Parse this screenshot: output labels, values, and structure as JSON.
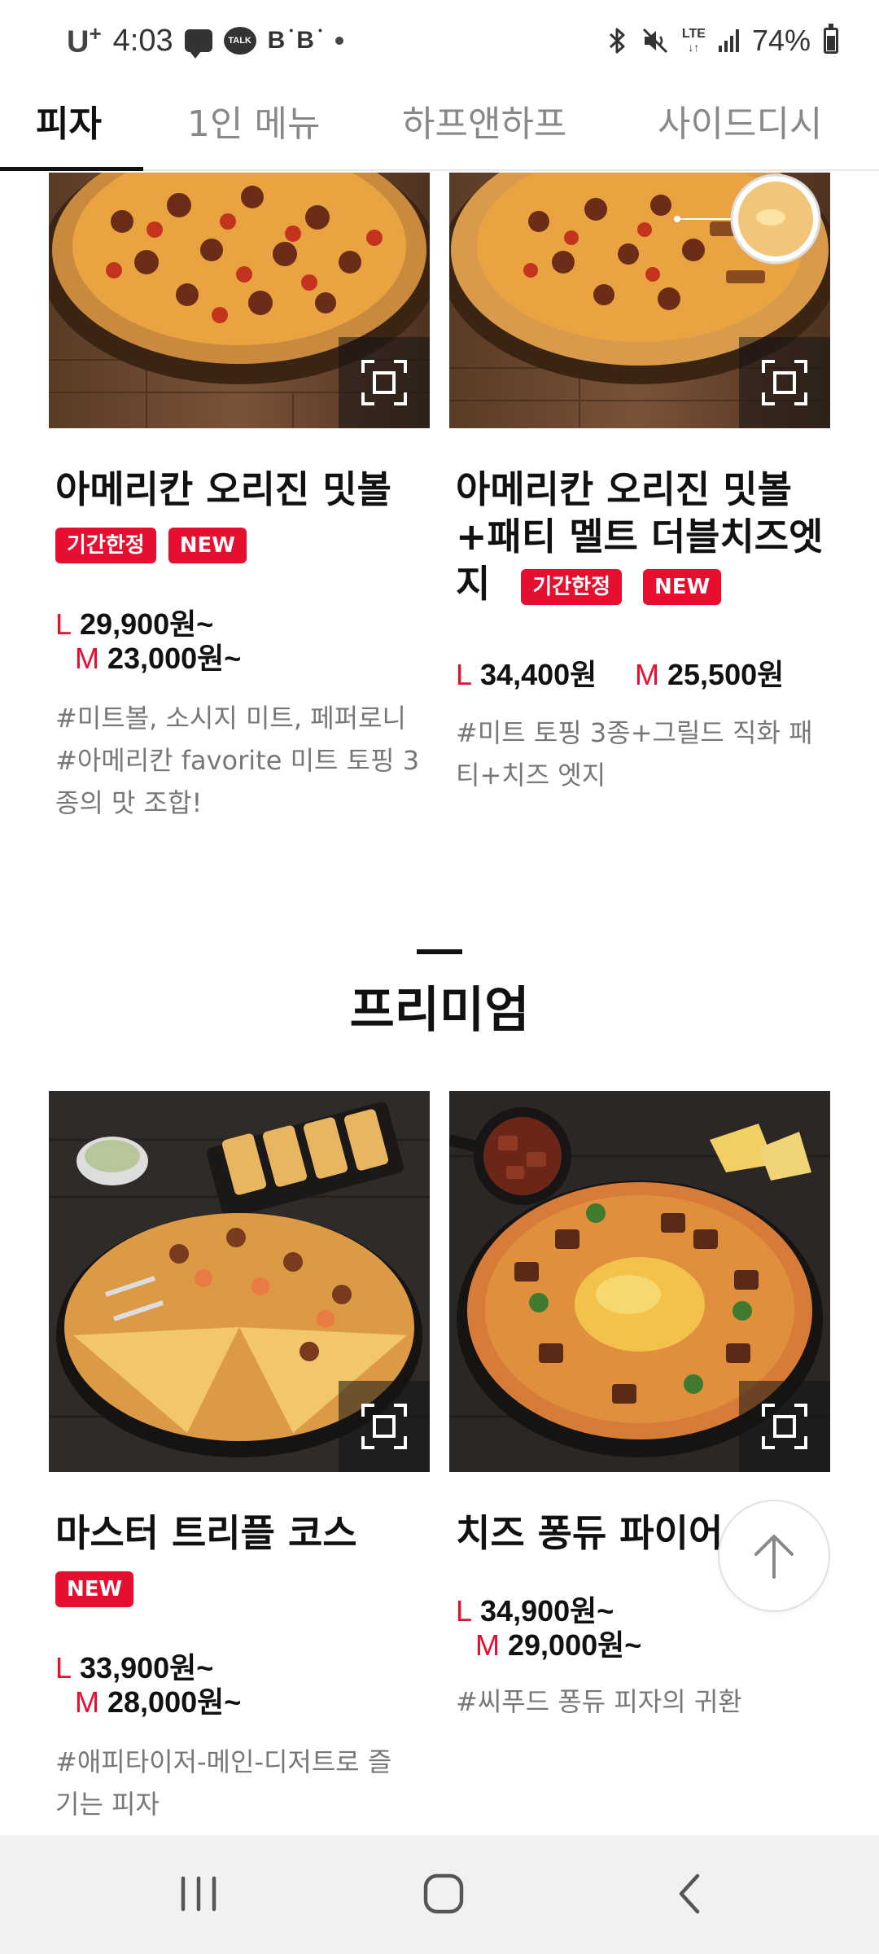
{
  "status_bar": {
    "carrier": "U",
    "carrier_sup": "+",
    "time": "4:03",
    "talk_label": "TALK",
    "b_label": "B",
    "network": "LTE",
    "battery": "74%"
  },
  "tabs": [
    {
      "label": "피자",
      "active": true
    },
    {
      "label": "1인 메뉴",
      "active": false
    },
    {
      "label": "하프앤하프",
      "active": false
    },
    {
      "label": "사이드디시",
      "active": false
    }
  ],
  "section_title": "프리미엄",
  "products": [
    {
      "name_lines": [
        "아메리칸 오리진 밋볼"
      ],
      "badges": [
        "기간한정",
        "NEW"
      ],
      "price_l": "29,900원~",
      "price_m": "23,000원~",
      "size_l": "L",
      "size_m": "M",
      "desc_lines": [
        "#미트볼, 소시지 미트, 페퍼로니",
        "#아메리칸 favorite 미트 토핑 3",
        "종의 맛 조합!"
      ]
    },
    {
      "name_lines": [
        "아메리칸 오리진 밋볼",
        "+패티 멜트 더블치즈엣",
        "지"
      ],
      "badges": [
        "기간한정",
        "NEW"
      ],
      "price_l": "34,400원",
      "price_m": "25,500원",
      "size_l": "L",
      "size_m": "M",
      "desc_lines": [
        "#미트 토핑 3종+그릴드 직화 패",
        "티+치즈 엣지"
      ]
    },
    {
      "name_lines": [
        "마스터 트리플 코스"
      ],
      "badges": [
        "NEW"
      ],
      "price_l": "33,900원~",
      "price_m": "28,000원~",
      "size_l": "L",
      "size_m": "M",
      "desc_lines": [
        "#애피타이저-메인-디저트로 즐",
        "기는 피자"
      ]
    },
    {
      "name_lines": [
        "치즈 퐁듀 파이어"
      ],
      "badges": [],
      "price_l": "34,900원~",
      "price_m": "29,000원~",
      "size_l": "L",
      "size_m": "M",
      "desc_lines": [
        "#씨푸드 퐁듀 피자의 귀환"
      ]
    }
  ],
  "colors": {
    "accent": "#e60f2f",
    "text": "#111111",
    "muted": "#777777",
    "tab_inactive": "#888888"
  },
  "icons": {
    "zoom": "zoom-frame-icon",
    "scroll_top": "arrow-up-icon",
    "nav_recent": "recent-apps-icon",
    "nav_home": "home-icon",
    "nav_back": "back-icon"
  }
}
